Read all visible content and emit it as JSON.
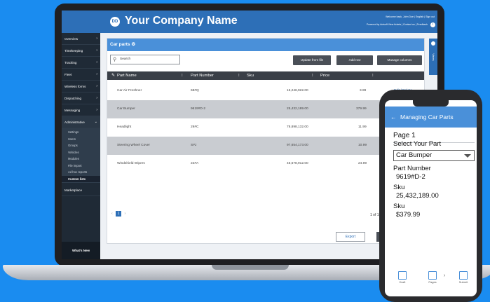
{
  "app": {
    "title": "Your Company Name",
    "logo_text": "DD",
    "header_top_links": "Welcome back, John Doe | English | Sign out",
    "header_links": "Powered by Actsoft    View tickets | Contact us | Feedback",
    "info_glyph": "i"
  },
  "sidebar": {
    "items": [
      {
        "label": "Overview"
      },
      {
        "label": "Timekeeping"
      },
      {
        "label": "Tracking"
      },
      {
        "label": "Fleet"
      },
      {
        "label": "Wireless forms"
      },
      {
        "label": "Dispatching"
      },
      {
        "label": "Messaging"
      },
      {
        "label": "Administrative"
      }
    ],
    "admin_subitems": [
      "Settings",
      "Users",
      "Groups",
      "Vehicles",
      "Modules",
      "File import",
      "Ad hoc reports",
      "Custom lists"
    ],
    "marketplace": "Marketplace",
    "whats_new": "What's New"
  },
  "panel": {
    "title": "Car parts ⚙",
    "search_placeholder": "Search",
    "buttons": {
      "update": "Update from file",
      "add": "Add row",
      "manage": "Manage columns"
    },
    "columns": [
      "Part Name",
      "Part Number",
      "Sku",
      "Price"
    ],
    "rows": [
      {
        "name": "Car Air Freshner",
        "number": "68#Q",
        "sku": "15,246,922.00",
        "price": "3.99",
        "actions": "Edit | Delete"
      },
      {
        "name": "Car Bumper",
        "number": "9619#D-2",
        "sku": "25,432,189.00",
        "price": "379.99",
        "actions": ""
      },
      {
        "name": "Headlight",
        "number": "29#C",
        "sku": "78,898,132.00",
        "price": "11.99",
        "actions": ""
      },
      {
        "name": "Steering Wheel Cover",
        "number": "S#J",
        "sku": "97,654,173.00",
        "price": "10.99",
        "actions": ""
      },
      {
        "name": "Windshield Wipers",
        "number": "22#A",
        "sku": "45,678,912.00",
        "price": "24.99",
        "actions": ""
      }
    ],
    "pager": {
      "prev": "‹",
      "current": "1",
      "next": "›",
      "count": "1 of 1 p"
    },
    "export_label": "Export",
    "side_tab_label": "Views"
  },
  "phone": {
    "header_title": "Managing Car Parts",
    "page_label": "Page 1",
    "select_label": "Select Your Part",
    "selected_part": "Car Bumper",
    "part_number_label": "Part Number",
    "part_number_value": "9619#D-2",
    "sku_label": "Sku",
    "sku_value": "25,432,189.00",
    "price_label": "Sku",
    "price_value": "$379.99",
    "footer": {
      "draft": "Draft",
      "pages": "Pages",
      "submit": "Submit"
    }
  },
  "colors": {
    "accent": "#2d6fb7",
    "light_accent": "#4a90d9",
    "background": "#1a8cf0",
    "sidebar": "#1f2a36"
  }
}
